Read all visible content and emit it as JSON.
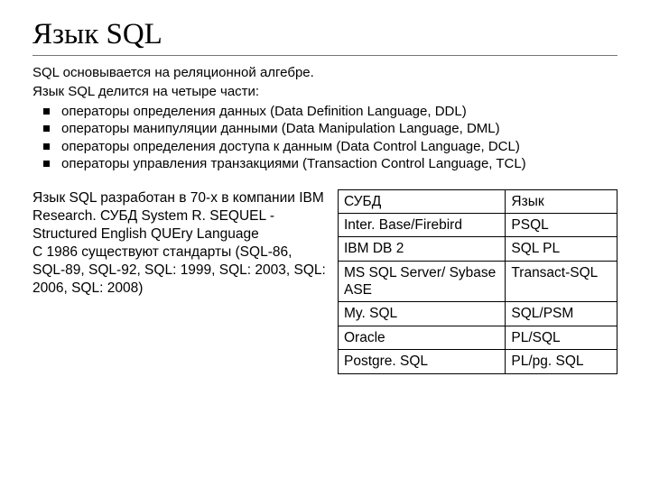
{
  "title": "Язык SQL",
  "intro": {
    "line1": "SQL основывается на реляционной алгебре.",
    "line2": "Язык SQL делится на четыре части:"
  },
  "bullets": [
    "операторы определения данных (Data Definition Language, DDL)",
    "операторы манипуляции данными (Data Manipulation Language, DML)",
    "операторы определения доступа к данным (Data Control Language, DCL)",
    "операторы управления транзакциями (Transaction Control Language, TCL)"
  ],
  "left_para": "Язык SQL разработан в 70-х в компании IBM Research. СУБД System R. SEQUEL - Structured English QUEry Language\nС 1986 существуют стандарты (SQL-86, SQL-89, SQL-92, SQL: 1999, SQL: 2003, SQL: 2006, SQL: 2008)",
  "table": [
    [
      "СУБД",
      "Язык"
    ],
    [
      "Inter. Base/Firebird",
      "PSQL"
    ],
    [
      "IBM DB 2",
      "SQL PL"
    ],
    [
      "MS SQL Server/ Sybase ASE",
      "Transact-SQL"
    ],
    [
      "My. SQL",
      "SQL/PSM"
    ],
    [
      "Oracle",
      "PL/SQL"
    ],
    [
      "Postgre. SQL",
      "PL/pg. SQL"
    ]
  ]
}
